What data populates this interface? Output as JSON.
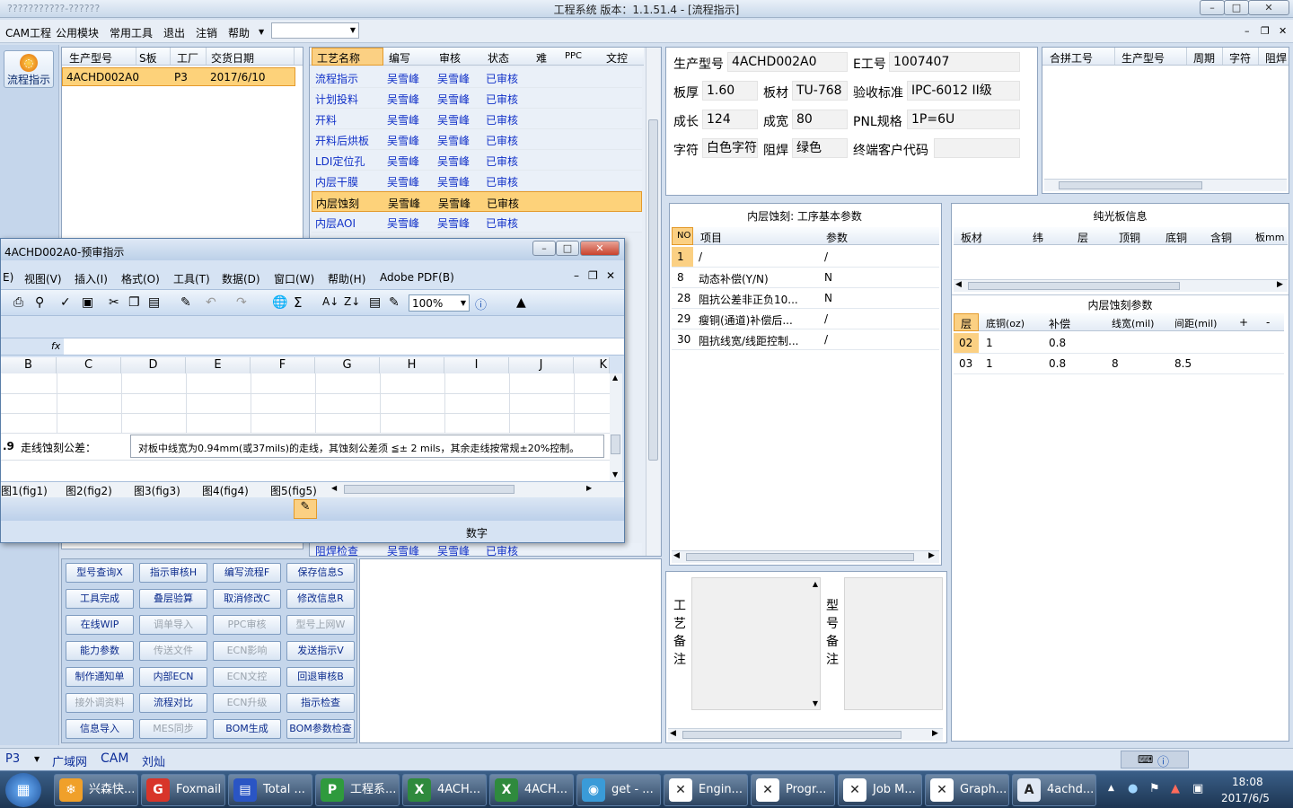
{
  "app": {
    "title_left": "???????????-??????",
    "title": "工程系统   版本：1.1.51.4 - [流程指示]"
  },
  "menu": [
    "CAM工程",
    "公用模块",
    "常用工具",
    "退出",
    "注销",
    "帮助"
  ],
  "left_nav": {
    "button_label": "流程指示"
  },
  "order_table": {
    "headers": [
      "生产型号",
      "S板",
      "工厂",
      "交货日期"
    ],
    "rows": [
      [
        "4ACHD002A0",
        "",
        "P3",
        "2017/6/10"
      ]
    ]
  },
  "process_table": {
    "headers": [
      "工艺名称",
      "编写",
      "审核",
      "状态",
      "难",
      "PPC",
      "文控"
    ],
    "rows": [
      [
        "流程指示",
        "吴雪峰",
        "吴雪峰",
        "已审核"
      ],
      [
        "计划投料",
        "吴雪峰",
        "吴雪峰",
        "已审核"
      ],
      [
        "开料",
        "吴雪峰",
        "吴雪峰",
        "已审核"
      ],
      [
        "开料后烘板",
        "吴雪峰",
        "吴雪峰",
        "已审核"
      ],
      [
        "LDI定位孔",
        "吴雪峰",
        "吴雪峰",
        "已审核"
      ],
      [
        "内层干膜",
        "吴雪峰",
        "吴雪峰",
        "已审核"
      ],
      [
        "内层蚀刻",
        "吴雪峰",
        "吴雪峰",
        "已审核"
      ],
      [
        "内层AOI",
        "吴雪峰",
        "吴雪峰",
        "已审核"
      ]
    ],
    "bottom_row": [
      "阻焊检查",
      "吴雪峰",
      "吴雪峰",
      "已审核"
    ]
  },
  "product_info": {
    "model_label": "生产型号",
    "model_value": "4ACHD002A0",
    "e_label": "E工号",
    "e_value": "1007407",
    "thickness_label": "板厚",
    "thickness_value": "1.60",
    "material_label": "板材",
    "material_value": "TU-768",
    "standard_label": "验收标准",
    "standard_value": "IPC-6012 II级",
    "length_label": "成长",
    "length_value": "124",
    "width_label": "成宽",
    "width_value": "80",
    "pnl_label": "PNL规格",
    "pnl_value": "1P=6U",
    "char_label": "字符",
    "char_value": "白色字符",
    "mask_label": "阻焊",
    "mask_value": "绿色",
    "customer_label": "终端客户代码",
    "customer_value": ""
  },
  "merge_table": {
    "headers": [
      "合拼工号",
      "生产型号",
      "周期",
      "字符",
      "阻焊"
    ]
  },
  "params": {
    "title": "内层蚀刻: 工序基本参数",
    "headers": [
      "NO",
      "项目",
      "参数"
    ],
    "rows": [
      [
        "1",
        "/",
        "/"
      ],
      [
        "8",
        "动态补偿(Y/N)",
        "N"
      ],
      [
        "28",
        "阻抗公差非正负10...",
        "N"
      ],
      [
        "29",
        "瘦铜(通道)补偿后...",
        "/"
      ],
      [
        "30",
        "阻抗线宽/线距控制...",
        "/"
      ]
    ]
  },
  "pure_board": {
    "title": "纯光板信息",
    "headers": [
      "板材",
      "纬",
      "层",
      "顶铜",
      "底铜",
      "含铜",
      "板mm"
    ]
  },
  "etch_params": {
    "title": "内层蚀刻参数",
    "headers": [
      "层",
      "底铜(oz)",
      "补偿",
      "线宽(mil)",
      "间距(mil)",
      "+",
      "-"
    ],
    "rows": [
      [
        "02",
        "1",
        "0.8",
        "",
        ""
      ],
      [
        "03",
        "1",
        "0.8",
        "8",
        "8.5"
      ]
    ]
  },
  "remarks": {
    "process_label": "工艺备注",
    "model_label": "型号备注"
  },
  "actions": [
    [
      "型号查询X",
      "指示审核H",
      "编写流程F",
      "保存信息S"
    ],
    [
      "工具完成",
      "叠层验算",
      "取消修改C",
      "修改信息R"
    ],
    [
      "在线WIP",
      "调单导入",
      "PPC审核",
      "型号上网W"
    ],
    [
      "能力参数",
      "传送文件",
      "ECN影响",
      "发送指示V"
    ],
    [
      "制作通知单",
      "内部ECN",
      "ECN文控",
      "回退审核B"
    ],
    [
      "接外调资料",
      "流程对比",
      "ECN升级",
      "指示检查"
    ],
    [
      "信息导入",
      "MES同步",
      "BOM生成",
      "BOM参数检查"
    ]
  ],
  "actions_disabled": [
    [
      0,
      0,
      0,
      0
    ],
    [
      0,
      0,
      0,
      0
    ],
    [
      0,
      1,
      1,
      1
    ],
    [
      0,
      1,
      1,
      0
    ],
    [
      0,
      0,
      1,
      0
    ],
    [
      1,
      0,
      1,
      0
    ],
    [
      0,
      1,
      0,
      0
    ]
  ],
  "excel": {
    "title": "4ACHD002A0-预审指示",
    "menu": [
      "E)",
      "视图(V)",
      "插入(I)",
      "格式(O)",
      "工具(T)",
      "数据(D)",
      "窗口(W)",
      "帮助(H)",
      "Adobe PDF(B)"
    ],
    "zoom": "100%",
    "fx": "fx",
    "columns": [
      "B",
      "C",
      "D",
      "E",
      "F",
      "G",
      "H",
      "I",
      "J",
      "K"
    ],
    "row_label": ".9",
    "cell_label": "走线蚀刻公差：",
    "cell_text": "对板中线宽为0.94mm(或37mils)的走线，其蚀刻公差须 ≦± 2 mils，其余走线按常规±20%控制。",
    "tabs": [
      "图1(fig1)",
      "图2(fig2)",
      "图3(fig3)",
      "图4(fig4)",
      "图5(fig5)"
    ],
    "status": "数字"
  },
  "statusbar": {
    "plant": "P3",
    "network": "广域网",
    "dept": "CAM",
    "user": "刘灿"
  },
  "taskbar": {
    "items": [
      "兴森快...",
      "Foxmail",
      "Total ...",
      "工程系...",
      "4ACH...",
      "4ACH...",
      "get - ...",
      "Engin...",
      "Progr...",
      "Job M...",
      "Graph...",
      "4achd..."
    ],
    "time": "18:08",
    "date": "2017/6/5"
  }
}
